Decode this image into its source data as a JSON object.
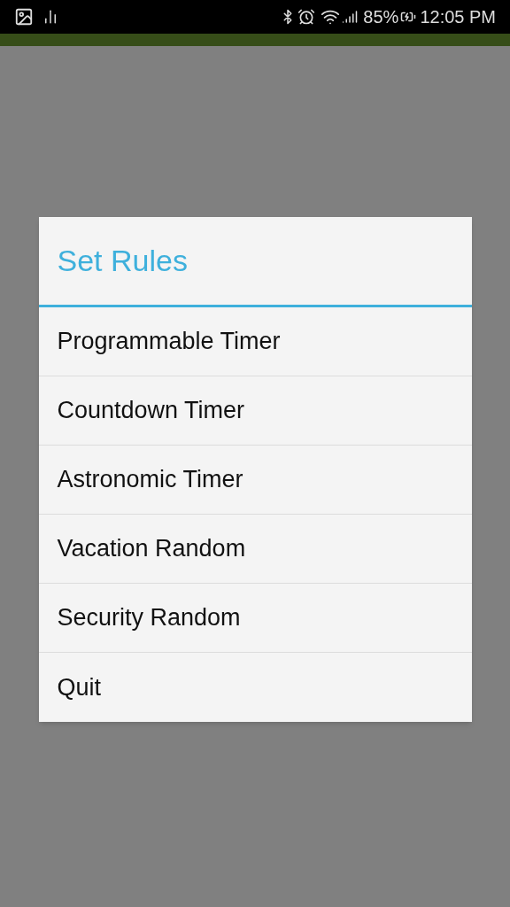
{
  "status_bar": {
    "battery": "85%",
    "time": "12:05 PM"
  },
  "dialog": {
    "title": "Set Rules",
    "items": [
      {
        "label": "Programmable Timer"
      },
      {
        "label": "Countdown Timer"
      },
      {
        "label": "Astronomic Timer"
      },
      {
        "label": "Vacation Random"
      },
      {
        "label": "Security Random"
      },
      {
        "label": "Quit"
      }
    ]
  }
}
